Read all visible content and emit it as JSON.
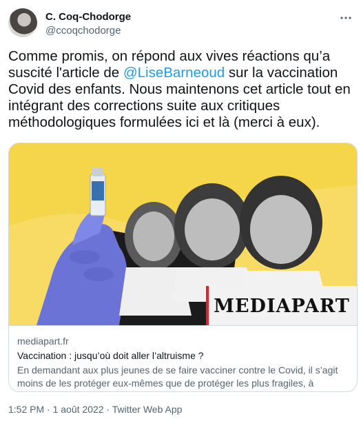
{
  "author": {
    "name": "C. Coq-Chodorge",
    "handle": "@ccoqchodorge"
  },
  "menu_icon": "more-options-icon",
  "tweet": {
    "text_before": "Comme promis, on répond aux vives réactions qu’a suscité l'article de ",
    "mention": "@LiseBarneoud",
    "text_after": " sur la vaccination Covid des enfants. Nous maintenons cet article tout en intégrant des corrections suite aux critiques méthodologiques formulées ici et là (merci à eux)."
  },
  "card": {
    "brand": "MEDIAPART",
    "domain": "mediapart.fr",
    "title": "Vaccination : jusqu’où doit aller l’altruisme ?",
    "description": "En demandant aux plus jeunes de se faire vacciner contre le Covid, il s’agit moins de les protéger eux-mêmes que de protéger les plus fragiles, à commencer par les …"
  },
  "meta": {
    "timestamp": "1:52 PM · 1 août 2022 · Twitter Web App"
  },
  "colors": {
    "mention": "#1d9bf0",
    "image_background": "#f5d54a",
    "brand_accent": "#e2232a"
  }
}
